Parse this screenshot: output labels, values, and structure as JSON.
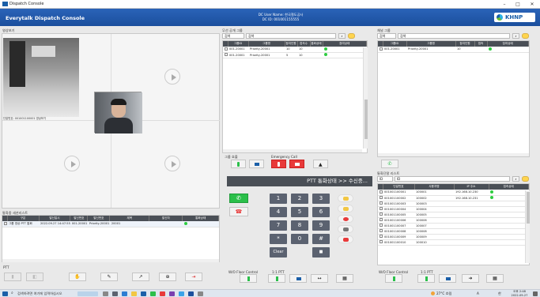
{
  "window": {
    "title": "Dispatch Console",
    "min": "–",
    "max": "□",
    "close": "✕"
  },
  "header": {
    "app_name": "Everytalk Dispatch Console",
    "user_line": "DC User Name:  한국철도공사",
    "id_line": "DC ID:  001001155555",
    "logo_text": "KHNP"
  },
  "video": {
    "title": "영상보기",
    "overlay_label": "단말번호: 001001100001 영상보기"
  },
  "dispatch": {
    "title": "통화중 세션리스트",
    "headers": [
      "",
      "구분",
      "발신일시",
      "발신번호",
      "발신번호",
      "제목",
      "발신자",
      "통화상태"
    ],
    "rows": [
      [
        "",
        "그룹 영상 PTT 통화",
        "2022.09.27 14:47:55",
        "001-20001",
        "Priority-20001",
        "20001",
        "",
        ""
      ]
    ],
    "ptt_label": "PTT"
  },
  "open_group": {
    "title": "무선 공개 그룹",
    "select": "검색",
    "search_value": "검색",
    "headers": [
      "",
      "그룹ID",
      "그룹명",
      "참여인원",
      "접속수",
      "통화상태",
      "참여상태"
    ],
    "rows": [
      [
        "",
        "001-20001",
        "Priority-20001",
        "10",
        "10",
        "",
        ""
      ],
      [
        "",
        "001-20001",
        "Priority-20001",
        "5",
        "10",
        "",
        ""
      ]
    ],
    "group_call_label": "그룹 호출",
    "emergency_label": "Emergency Call"
  },
  "channel": {
    "title": "채널 그룹",
    "select": "검색",
    "search_value": "검색",
    "headers": [
      "",
      "그룹ID",
      "그룹명",
      "참여인원",
      "접속",
      "참여상태"
    ],
    "rows": [
      [
        "",
        "001-20001",
        "Priority-20001",
        "10",
        "",
        ""
      ]
    ]
  },
  "ptt_status": {
    "text": "PTT 통화상태 >> 수신중..."
  },
  "keypad": {
    "keys": [
      "1",
      "2",
      "3",
      "4",
      "5",
      "6",
      "7",
      "8",
      "9",
      "*",
      "0",
      "#"
    ],
    "clear": "Clear"
  },
  "terminals": {
    "title": "통화단말 리스트",
    "select": "ID",
    "search_value": "ID",
    "headers": [
      "",
      "단말번호",
      "사용자명",
      "IP 주소",
      "접속상태"
    ],
    "rows": [
      [
        "",
        "001001100001",
        "100001",
        "192.168.10.230",
        "on"
      ],
      [
        "",
        "001001100002",
        "100002",
        "192.168.10.231",
        "on"
      ],
      [
        "",
        "001001100003",
        "100003",
        "",
        ""
      ],
      [
        "",
        "001001100004",
        "100004",
        "",
        ""
      ],
      [
        "",
        "001001100005",
        "100005",
        "",
        ""
      ],
      [
        "",
        "001001100006",
        "100006",
        "",
        ""
      ],
      [
        "",
        "001001100007",
        "100007",
        "",
        ""
      ],
      [
        "",
        "001001100008",
        "100008",
        "",
        ""
      ],
      [
        "",
        "001001100009",
        "100009",
        "",
        ""
      ],
      [
        "",
        "001001100010",
        "100010",
        "",
        ""
      ]
    ]
  },
  "floor": {
    "center_label": "W/O Floor Control",
    "center_label2": "1:1 PTT",
    "right_label": "W/O Floor Control",
    "right_label2": "1:1 PTT"
  },
  "taskbar": {
    "search_placeholder": "검색하려면 여기에 입력하십시오",
    "weather": "27°C 흐림",
    "ime": "A",
    "lang": "한",
    "time": "오후 2:48",
    "date": "2022-09-27"
  },
  "colors": {
    "header": "#1b4f9d",
    "green_button": "#2bbf4a",
    "red_button": "#e83a3a",
    "key": "#5b6270",
    "table_header": "#4a4f56"
  }
}
